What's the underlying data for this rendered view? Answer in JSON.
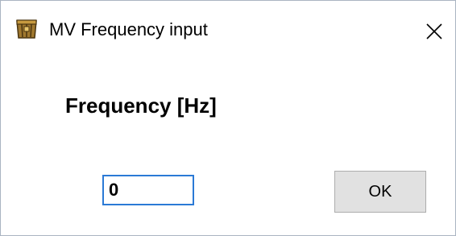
{
  "window": {
    "title": "MV Frequency input",
    "icon": "app-crate-icon",
    "close_icon": "close-icon"
  },
  "form": {
    "label": "Frequency [Hz]",
    "frequency_value": "0"
  },
  "buttons": {
    "ok_label": "OK"
  },
  "colors": {
    "input_border": "#2b7ad6",
    "button_bg": "#e1e1e1",
    "button_border": "#adadad",
    "window_border": "#aab4c2"
  }
}
